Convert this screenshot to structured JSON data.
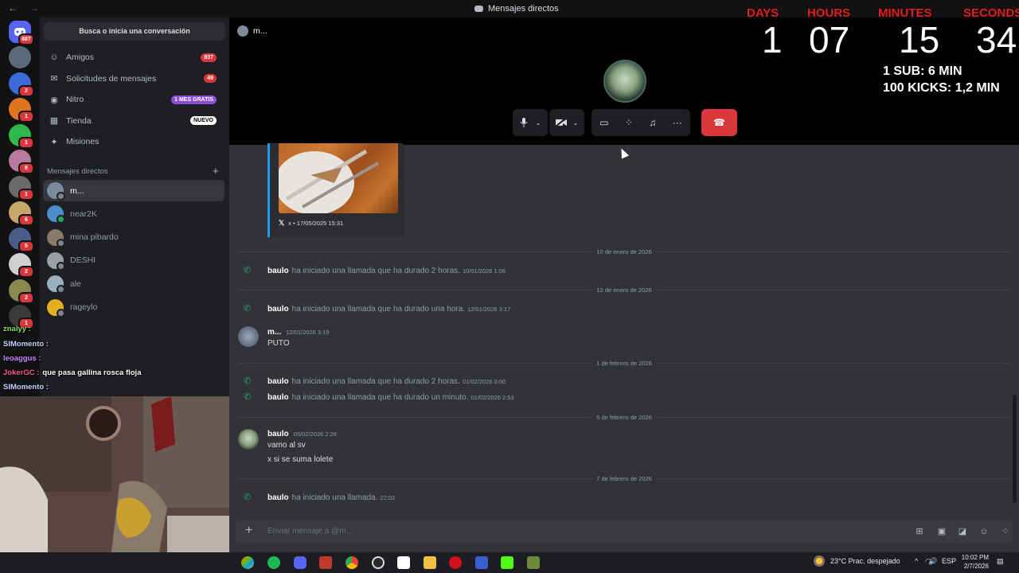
{
  "titlebar": {
    "title": "Mensajes directos",
    "back": "←",
    "forward": "→"
  },
  "rail": {
    "home_badge": "887",
    "servers": [
      {
        "color": "#5b6b7a",
        "badge": ""
      },
      {
        "color": "#3a6bd9",
        "badge": "2"
      },
      {
        "color": "#e0751f",
        "badge": "1"
      },
      {
        "color": "#2fb84a",
        "badge": "1"
      },
      {
        "color": "#b87aa0",
        "badge": "8"
      },
      {
        "color": "#6a6a6a",
        "badge": "1"
      },
      {
        "color": "#c7a86b",
        "badge": "6"
      },
      {
        "color": "#4a5e8a",
        "badge": "5"
      },
      {
        "color": "#d0d0d0",
        "badge": "2"
      },
      {
        "color": "#8a8a50",
        "badge": "2"
      },
      {
        "color": "#3a3a3a",
        "badge": "1"
      }
    ]
  },
  "sidebar": {
    "search_label": "Busca o inicia una conversación",
    "nav": [
      {
        "label": "Amigos",
        "icon": "friends-icon",
        "pill": "837",
        "pill_color": "#da373c"
      },
      {
        "label": "Solicitudes de mensajes",
        "icon": "envelope-icon",
        "pill": "49",
        "pill_color": "#da373c"
      },
      {
        "label": "Nitro",
        "icon": "nitro-icon",
        "pill": "1 MES GRATIS",
        "pill_color": "#8c4fd6"
      },
      {
        "label": "Tienda",
        "icon": "shop-icon",
        "pill": "NUEVO",
        "pill_color": "#ffffff"
      },
      {
        "label": "Misiones",
        "icon": "quests-icon",
        "pill": "",
        "pill_color": ""
      }
    ],
    "dm_header": "Mensajes directos",
    "dms": [
      {
        "name": "m...",
        "color": "#7d8a9c",
        "status": "#80848e",
        "active": true
      },
      {
        "name": "near2K",
        "color": "#4d8bc9",
        "status": "#23a55a",
        "active": false
      },
      {
        "name": "mina pibardo",
        "color": "#8a7a6a",
        "status": "#80848e",
        "active": false
      },
      {
        "name": "DESHI",
        "color": "#9aa0a6",
        "status": "#80848e",
        "active": false
      },
      {
        "name": "ale",
        "color": "#9ab0c0",
        "status": "#80848e",
        "active": false
      },
      {
        "name": "rageylo",
        "color": "#e0b020",
        "status": "#80848e",
        "active": false
      }
    ]
  },
  "stream_chat": [
    {
      "user": "znalyy :",
      "text": "",
      "color": "#8fdc6a"
    },
    {
      "user": "SIMomento :",
      "text": "",
      "color": "#c0d8ff"
    },
    {
      "user": "leoaggus :",
      "text": "",
      "color": "#c98cff"
    },
    {
      "user": "JokerGC :",
      "text": "que pasa gallina rosca floja",
      "color": "#ff5a8a"
    },
    {
      "user": "SIMomento :",
      "text": "",
      "color": "#c0d8ff"
    }
  ],
  "countdown": {
    "labels": [
      "DAYS",
      "HOURS",
      "MINUTES",
      "SECONDS"
    ],
    "values": [
      "1",
      "07",
      "15",
      "34"
    ],
    "note1": "1 SUB: 6 MIN",
    "note2": "100 KICKS: 1,2 MIN"
  },
  "header": {
    "channel_name": "m..."
  },
  "embed": {
    "footer": "x • 17/05/2025 15:31"
  },
  "messages": {
    "sep1": "10 de enero de 2026",
    "call1": {
      "who": "baulo",
      "text": "ha iniciado una llamada que ha durado 2 horas.",
      "ts": "10/01/2026 1:06"
    },
    "sep2": "12 de enero de 2026",
    "call2": {
      "who": "baulo",
      "text": "ha iniciado una llamada que ha durado una hora.",
      "ts": "12/01/2026 3:17"
    },
    "msg1": {
      "who": "m...",
      "ts": "12/01/2026 3:19",
      "line": "PUTO"
    },
    "sep3": "1 de febrero de 2026",
    "call3": {
      "who": "baulo",
      "text": "ha iniciado una llamada que ha durado 2 horas.",
      "ts": "01/02/2026 0:00"
    },
    "call4": {
      "who": "baulo",
      "text": "ha iniciado una llamada que ha durado un minuto.",
      "ts": "01/02/2026 2:53"
    },
    "sep4": "5 de febrero de 2026",
    "msg2": {
      "who": "baulo",
      "ts": "05/02/2026 2:26",
      "line1": "vamo al sv",
      "line2": "x si se suma lolete"
    },
    "sep5": "7 de febrero de 2026",
    "call5": {
      "who": "baulo",
      "text": "ha iniciado una llamada.",
      "ts": "22:02"
    }
  },
  "composer": {
    "placeholder": "Enviar mensaje a @m..."
  },
  "taskbar": {
    "weather": "23°C  Prac. despejado",
    "lang": "ESP",
    "time": "10:02 PM",
    "date": "2/7/2026"
  }
}
